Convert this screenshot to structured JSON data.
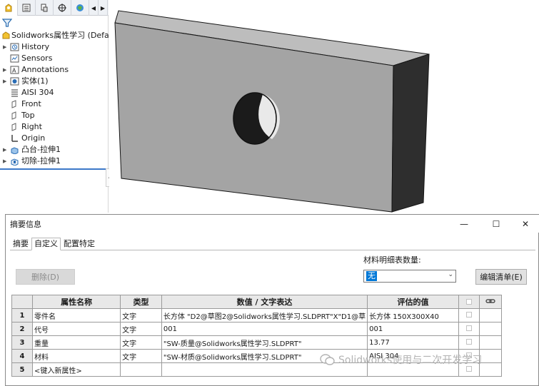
{
  "feature_manager": {
    "tabs": [
      "feature-manager",
      "property-manager",
      "configuration-manager",
      "dimxpert-manager",
      "display-manager"
    ],
    "root": "Solidworks属性学习  (Default",
    "items": [
      {
        "label": "History",
        "expandable": true
      },
      {
        "label": "Sensors",
        "expandable": false
      },
      {
        "label": "Annotations",
        "expandable": true
      },
      {
        "label": "实体(1)",
        "expandable": true
      },
      {
        "label": "AISI 304",
        "expandable": false
      },
      {
        "label": "Front",
        "expandable": false
      },
      {
        "label": "Top",
        "expandable": false
      },
      {
        "label": "Right",
        "expandable": false
      },
      {
        "label": "Origin",
        "expandable": false
      },
      {
        "label": "凸台-拉伸1",
        "expandable": true
      },
      {
        "label": "切除-拉伸1",
        "expandable": true
      }
    ]
  },
  "dialog": {
    "title": "摘要信息",
    "tabs": [
      "摘要",
      "自定义",
      "配置特定"
    ],
    "active_tab": "自定义",
    "delete_button": "删除(D)",
    "bom_qty_label": "材料明细表数量:",
    "bom_qty_value": "无",
    "edit_list_button": "编辑清单(E)",
    "table": {
      "headers": [
        "属性名称",
        "类型",
        "数值 / 文字表达",
        "评估的值"
      ],
      "rows": [
        {
          "num": "1",
          "name": "零件名",
          "type": "文字",
          "value": "长方体 \"D2@草图2@Solidworks属性学习.SLDPRT\"X\"D1@草",
          "evaluated": "长方体 150X300X40"
        },
        {
          "num": "2",
          "name": "代号",
          "type": "文字",
          "value": "001",
          "evaluated": "001"
        },
        {
          "num": "3",
          "name": "重量",
          "type": "文字",
          "value": "\"SW-质量@Solidworks属性学习.SLDPRT\"",
          "evaluated": "13.77"
        },
        {
          "num": "4",
          "name": "材料",
          "type": "文字",
          "value": "\"SW-材质@Solidworks属性学习.SLDPRT\"",
          "evaluated": "AISI 304"
        },
        {
          "num": "5",
          "name": "<键入新属性>",
          "type": "",
          "value": "",
          "evaluated": ""
        }
      ]
    }
  },
  "watermark": "Solidworks使用与二次开发学习",
  "colors": {
    "selection_blue": "#0078d7",
    "part_front": "#a4a4a4",
    "part_top": "#bdbdbd",
    "part_side": "#2e2e2e"
  }
}
